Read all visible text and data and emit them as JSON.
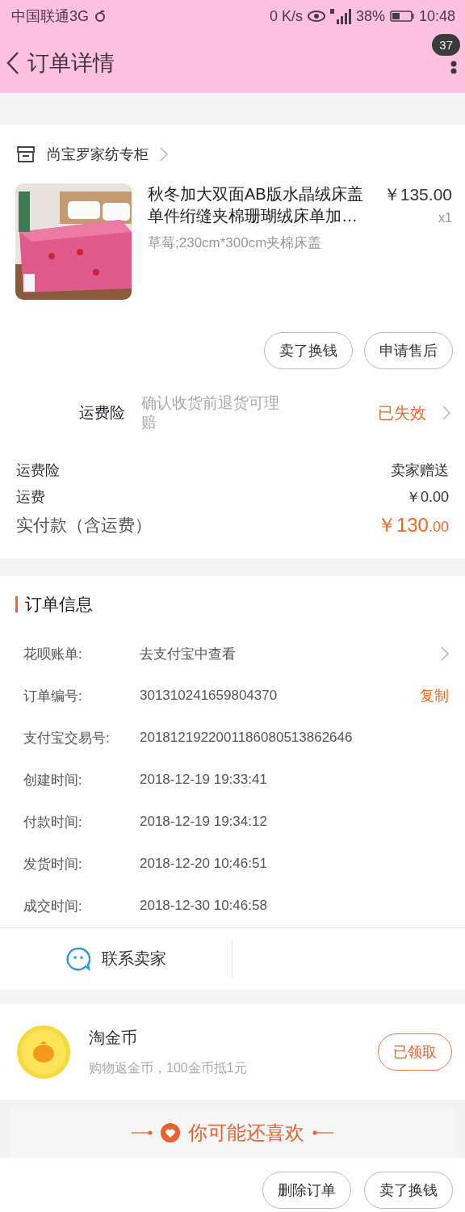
{
  "status_bar": {
    "carrier": "中国联通3G",
    "speed": "0 K/s",
    "battery": "38%",
    "time": "10:48"
  },
  "header": {
    "title": "订单详情",
    "badge": "37"
  },
  "shop": {
    "name": "尚宝罗家纺专柜"
  },
  "product": {
    "kind": "picture",
    "title": "秋冬加大双面AB版水晶绒床盖单件绗缝夹棉珊瑚绒床单加…",
    "price": "￥135.00",
    "quantity": "x1",
    "sku": "草莓;230cm*300cm夹棉床盖"
  },
  "item_buttons": [
    "卖了换钱",
    "申请售后"
  ],
  "insurance": {
    "label": "运费险",
    "description": "确认收货前退货可理赔",
    "status": "已失效"
  },
  "fees": [
    {
      "label": "运费险",
      "value": "卖家赠送"
    },
    {
      "label": "运费",
      "value": "￥0.00"
    }
  ],
  "total": {
    "label": "实付款（含运费）",
    "amount": "￥130",
    "decimals": ".00"
  },
  "order_info": {
    "title": "订单信息",
    "rows": [
      {
        "label": "花呗账单:",
        "value": "去支付宝中查看",
        "chevron": true
      },
      {
        "label": "订单编号:",
        "value": "301310241659804370",
        "action": "复制",
        "chevron": false
      },
      {
        "label": "支付宝交易号:",
        "value": "2018121922001186080513862646",
        "chevron": false
      },
      {
        "label": "创建时间:",
        "value": "2018-12-19 19:33:41",
        "chevron": false
      },
      {
        "label": "付款时间:",
        "value": "2018-12-19 19:34:12",
        "chevron": false
      },
      {
        "label": "发货时间:",
        "value": "2018-12-20 10:46:51",
        "chevron": false
      },
      {
        "label": "成交时间:",
        "value": "2018-12-30 10:46:58",
        "chevron": false
      }
    ]
  },
  "contact": {
    "label": "联系卖家"
  },
  "coins": {
    "title": "淘金币",
    "description": "购物返金币，100金币抵1元",
    "button": "已领取"
  },
  "recommend": {
    "title": "你可能还喜欢"
  },
  "bottom_buttons": [
    "删除订单",
    "卖了换钱"
  ]
}
